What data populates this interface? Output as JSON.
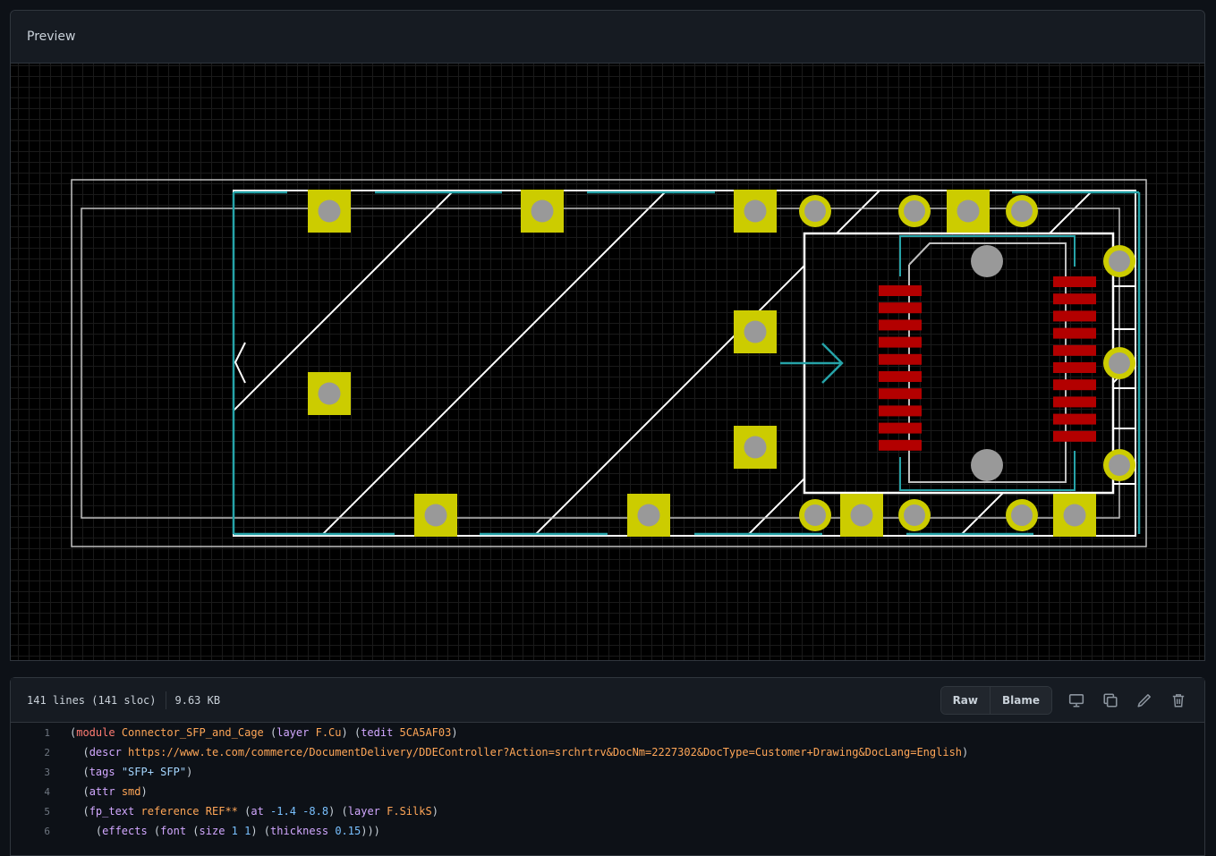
{
  "preview": {
    "title": "Preview"
  },
  "pcb": {
    "colors": {
      "background": "#000000",
      "grid": "#1a1a1a",
      "outline": "#ffffff",
      "courtyard": "#bfbfbf",
      "fab": "#26a3a8",
      "pad": "#cccc00",
      "drill": "#999999",
      "smd_pad": "#b30000"
    }
  },
  "file": {
    "lines_info": "141 lines (141 sloc)",
    "size": "9.63 KB",
    "raw_label": "Raw",
    "blame_label": "Blame"
  },
  "code": {
    "lines": [
      {
        "n": "1",
        "tokens": [
          [
            "p",
            "("
          ],
          [
            "k",
            "module"
          ],
          [
            "p",
            " "
          ],
          [
            "v",
            "Connector_SFP_and_Cage"
          ],
          [
            "p",
            " ("
          ],
          [
            "f",
            "layer"
          ],
          [
            "p",
            " "
          ],
          [
            "v",
            "F.Cu"
          ],
          [
            "p",
            ") ("
          ],
          [
            "f",
            "tedit"
          ],
          [
            "p",
            " "
          ],
          [
            "v",
            "5CA5AF03"
          ],
          [
            "p",
            ")"
          ]
        ]
      },
      {
        "n": "2",
        "tokens": [
          [
            "p",
            "  ("
          ],
          [
            "f",
            "descr"
          ],
          [
            "p",
            " "
          ],
          [
            "v",
            "https://www.te.com/commerce/DocumentDelivery/DDEController?Action=srchrtrv&DocNm=2227302&DocType=Customer+Drawing&DocLang=English"
          ],
          [
            "p",
            ")"
          ]
        ]
      },
      {
        "n": "3",
        "tokens": [
          [
            "p",
            "  ("
          ],
          [
            "f",
            "tags"
          ],
          [
            "p",
            " "
          ],
          [
            "s",
            "\"SFP+ SFP\""
          ],
          [
            "p",
            ")"
          ]
        ]
      },
      {
        "n": "4",
        "tokens": [
          [
            "p",
            "  ("
          ],
          [
            "f",
            "attr"
          ],
          [
            "p",
            " "
          ],
          [
            "v",
            "smd"
          ],
          [
            "p",
            ")"
          ]
        ]
      },
      {
        "n": "5",
        "tokens": [
          [
            "p",
            "  ("
          ],
          [
            "f",
            "fp_text"
          ],
          [
            "p",
            " "
          ],
          [
            "v",
            "reference"
          ],
          [
            "p",
            " "
          ],
          [
            "v",
            "REF**"
          ],
          [
            "p",
            " ("
          ],
          [
            "f",
            "at"
          ],
          [
            "p",
            " "
          ],
          [
            "n",
            "-1.4"
          ],
          [
            "p",
            " "
          ],
          [
            "n",
            "-8.8"
          ],
          [
            "p",
            ") ("
          ],
          [
            "f",
            "layer"
          ],
          [
            "p",
            " "
          ],
          [
            "v",
            "F.SilkS"
          ],
          [
            "p",
            ")"
          ]
        ]
      },
      {
        "n": "6",
        "tokens": [
          [
            "p",
            "    ("
          ],
          [
            "f",
            "effects"
          ],
          [
            "p",
            " ("
          ],
          [
            "f",
            "font"
          ],
          [
            "p",
            " ("
          ],
          [
            "f",
            "size"
          ],
          [
            "p",
            " "
          ],
          [
            "n",
            "1"
          ],
          [
            "p",
            " "
          ],
          [
            "n",
            "1"
          ],
          [
            "p",
            ") ("
          ],
          [
            "f",
            "thickness"
          ],
          [
            "p",
            " "
          ],
          [
            "n",
            "0.15"
          ],
          [
            "p",
            ")))"
          ]
        ]
      }
    ]
  }
}
